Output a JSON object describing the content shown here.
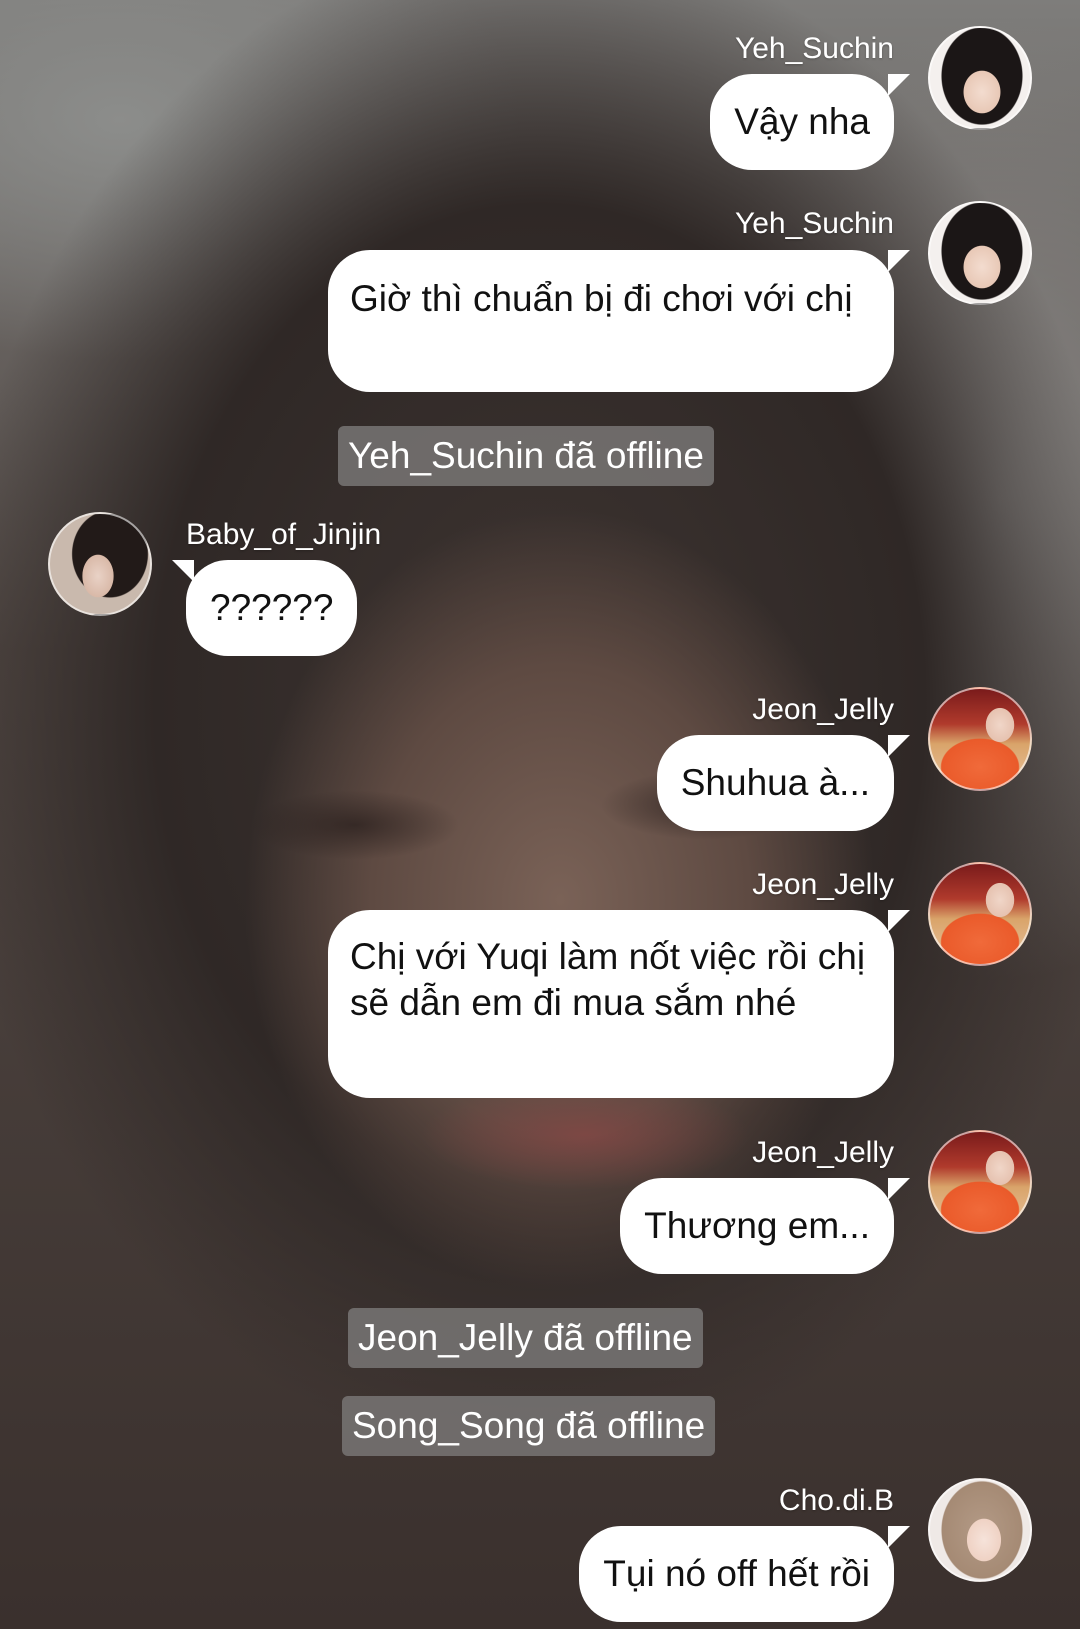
{
  "messages": [
    {
      "sender": "Yeh_Suchin",
      "text": "Vậy nha"
    },
    {
      "sender": "Yeh_Suchin",
      "text": "Giờ thì chuẩn bị đi chơi với chị"
    },
    {
      "sender": "Baby_of_Jinjin",
      "text": "??????"
    },
    {
      "sender": "Jeon_Jelly",
      "text": "Shuhua à..."
    },
    {
      "sender": "Jeon_Jelly",
      "text": "Chị với Yuqi làm nốt việc rồi chị sẽ dẫn em đi mua sắm nhé"
    },
    {
      "sender": "Jeon_Jelly",
      "text": "Thương em..."
    },
    {
      "sender": "Cho.di.B",
      "text": "Tụi nó off hết rồi"
    }
  ],
  "system_notices": [
    "Yeh_Suchin đã offline",
    "Jeon_Jelly đã offline",
    "Song_Song đã offline"
  ],
  "colors": {
    "bubble": "#ffffff",
    "bubble_text": "#111111",
    "name_text": "#ffffff",
    "notice_bg": "#787674"
  }
}
